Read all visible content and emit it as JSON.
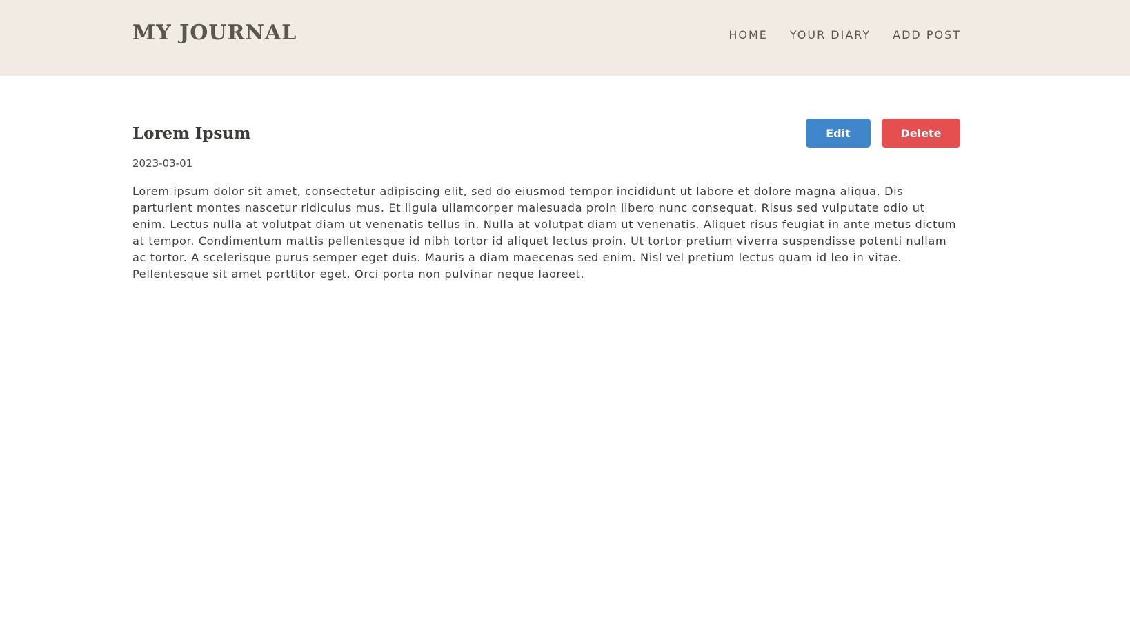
{
  "header": {
    "brand": "MY JOURNAL",
    "nav": [
      {
        "label": "HOME"
      },
      {
        "label": "YOUR DIARY"
      },
      {
        "label": "ADD POST"
      }
    ]
  },
  "post": {
    "title": "Lorem Ipsum",
    "date": "2023-03-01",
    "body": "Lorem ipsum dolor sit amet, consectetur adipiscing elit, sed do eiusmod tempor incididunt ut labore et dolore magna aliqua. Dis parturient montes nascetur ridiculus mus. Et ligula ullamcorper malesuada proin libero nunc consequat. Risus sed vulputate odio ut enim. Lectus nulla at volutpat diam ut venenatis tellus in. Nulla at volutpat diam ut venenatis. Aliquet risus feugiat in ante metus dictum at tempor. Condimentum mattis pellentesque id nibh tortor id aliquet lectus proin. Ut tortor pretium viverra suspendisse potenti nullam ac tortor. A scelerisque purus semper eget duis. Mauris a diam maecenas sed enim. Nisl vel pretium lectus quam id leo in vitae. Pellentesque sit amet porttitor eget. Orci porta non pulvinar neque laoreet.",
    "edit_label": "Edit",
    "delete_label": "Delete"
  },
  "colors": {
    "header_background": "#f2ebe3",
    "edit_button": "#3f86cb",
    "delete_button": "#e64f50"
  }
}
